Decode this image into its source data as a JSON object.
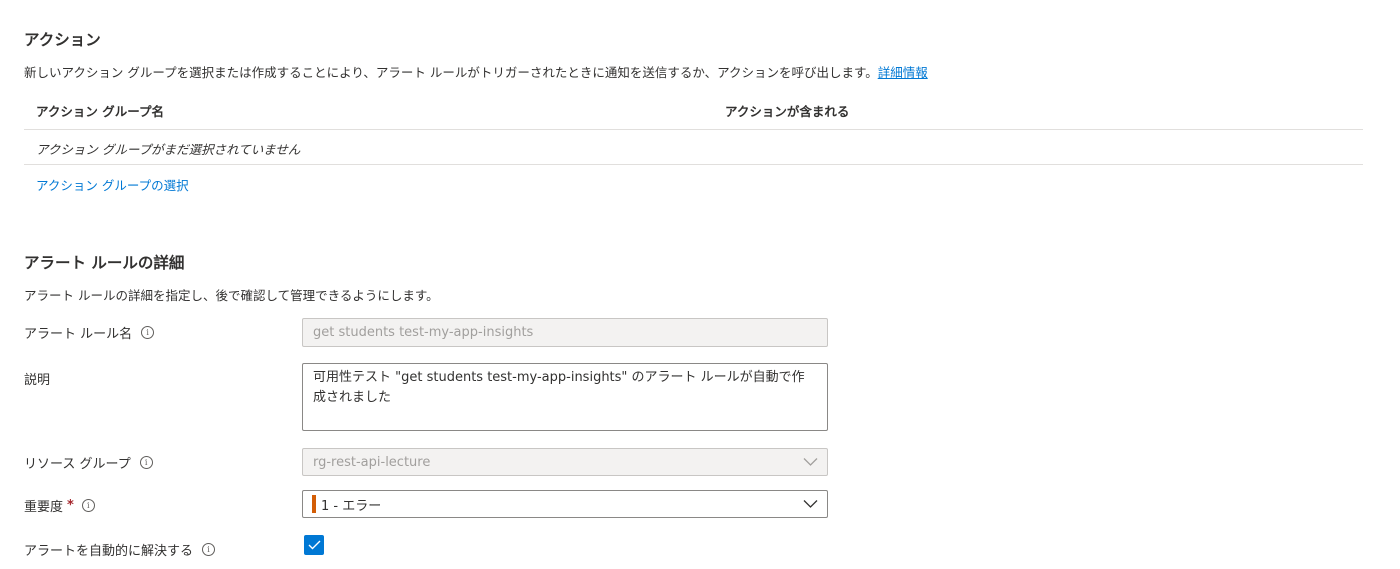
{
  "actions": {
    "title": "アクション",
    "description": "新しいアクション グループを選択または作成することにより、アラート ルールがトリガーされたときに通知を送信するか、アクションを呼び出します。",
    "learn_more": "詳細情報",
    "table": {
      "col_name": "アクション グループ名",
      "col_actions": "アクションが含まれる",
      "empty_row": "アクション グループがまだ選択されていません"
    },
    "select_link": "アクション グループの選択"
  },
  "details": {
    "title": "アラート ルールの詳細",
    "description": "アラート ルールの詳細を指定し、後で確認して管理できるようにします。",
    "rule_name": {
      "label": "アラート ルール名",
      "value": "get students test-my-app-insights"
    },
    "description_field": {
      "label": "説明",
      "value": "可用性テスト \"get students test-my-app-insights\" のアラート ルールが自動で作成されました"
    },
    "resource_group": {
      "label": "リソース グループ",
      "value": "rg-rest-api-lecture"
    },
    "severity": {
      "label": "重要度",
      "required_mark": "*",
      "value": "1 - エラー",
      "color": "#d35d06"
    },
    "auto_resolve": {
      "label": "アラートを自動的に解決する",
      "checked": true
    }
  },
  "colors": {
    "accent": "#0078d4",
    "text": "#323130",
    "disabled_bg": "#f3f2f1",
    "required": "#a4262c"
  },
  "icons": {
    "info": "info-icon",
    "chevron": "chevron-down-icon",
    "check": "checkmark-icon"
  }
}
